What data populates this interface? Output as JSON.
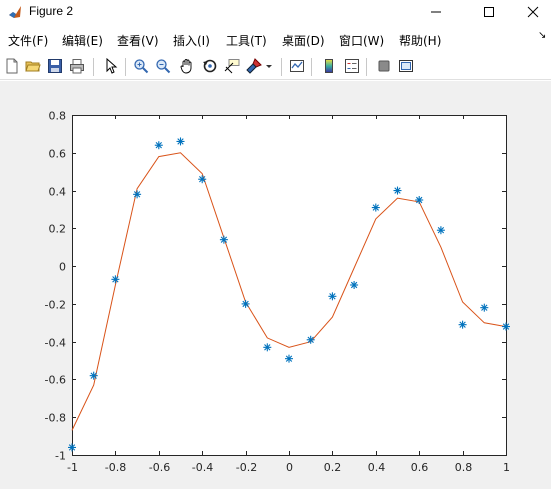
{
  "window": {
    "title": "Figure 2",
    "minimize_icon": "minimize-icon",
    "maximize_icon": "maximize-icon",
    "close_icon": "close-icon"
  },
  "menu": {
    "items": [
      {
        "label": "文件(F)"
      },
      {
        "label": "编辑(E)"
      },
      {
        "label": "查看(V)"
      },
      {
        "label": "插入(I)"
      },
      {
        "label": "工具(T)"
      },
      {
        "label": "桌面(D)"
      },
      {
        "label": "窗口(W)"
      },
      {
        "label": "帮助(H)"
      }
    ]
  },
  "toolbar": {
    "icons": [
      "new-figure-icon",
      "open-file-icon",
      "save-icon",
      "print-icon",
      "pointer-icon",
      "zoom-in-icon",
      "zoom-out-icon",
      "pan-icon",
      "rotate-icon",
      "data-cursor-icon",
      "brush-icon",
      "link-plot-icon",
      "colorbar-icon",
      "legend-icon",
      "hide-plot-tools-icon",
      "show-plot-tools-icon"
    ]
  },
  "colors": {
    "scatter": "#0072BD",
    "line": "#D95319",
    "axes_bg": "#ffffff",
    "figure_bg": "#f0f0f0"
  },
  "chart_data": {
    "type": "line",
    "xlim": [
      -1,
      1
    ],
    "ylim": [
      -1,
      0.8
    ],
    "xticks": [
      -1,
      -0.8,
      -0.6,
      -0.4,
      -0.2,
      0,
      0.2,
      0.4,
      0.6,
      0.8,
      1
    ],
    "xtick_labels": [
      "-1",
      "-0.8",
      "-0.6",
      "-0.4",
      "-0.2",
      "0",
      "0.2",
      "0.4",
      "0.6",
      "0.8",
      "1"
    ],
    "yticks": [
      -1,
      -0.8,
      -0.6,
      -0.4,
      -0.2,
      0,
      0.2,
      0.4,
      0.6,
      0.8
    ],
    "ytick_labels": [
      "-1",
      "-0.8",
      "-0.6",
      "-0.4",
      "-0.2",
      "0",
      "0.2",
      "0.4",
      "0.6",
      "0.8"
    ],
    "grid": false,
    "series": [
      {
        "style": "markers",
        "marker": "*",
        "x": [
          -1,
          -0.9,
          -0.8,
          -0.7,
          -0.6,
          -0.5,
          -0.4,
          -0.3,
          -0.2,
          -0.1,
          0,
          0.1,
          0.2,
          0.3,
          0.4,
          0.5,
          0.6,
          0.7,
          0.8,
          0.9,
          1
        ],
        "y": [
          -0.96,
          -0.58,
          -0.07,
          0.38,
          0.64,
          0.66,
          0.46,
          0.14,
          -0.2,
          -0.43,
          -0.49,
          -0.39,
          -0.16,
          -0.1,
          0.31,
          0.4,
          0.35,
          0.19,
          -0.31,
          -0.22,
          -0.32
        ]
      },
      {
        "style": "line",
        "x": [
          -1,
          -0.9,
          -0.8,
          -0.7,
          -0.6,
          -0.5,
          -0.4,
          -0.3,
          -0.2,
          -0.1,
          0,
          0.1,
          0.2,
          0.3,
          0.4,
          0.5,
          0.6,
          0.7,
          0.8,
          0.9,
          1
        ],
        "y": [
          -0.87,
          -0.63,
          -0.1,
          0.41,
          0.58,
          0.6,
          0.49,
          0.15,
          -0.19,
          -0.38,
          -0.43,
          -0.4,
          -0.27,
          -0.01,
          0.25,
          0.36,
          0.34,
          0.1,
          -0.19,
          -0.3,
          -0.32
        ]
      }
    ]
  }
}
